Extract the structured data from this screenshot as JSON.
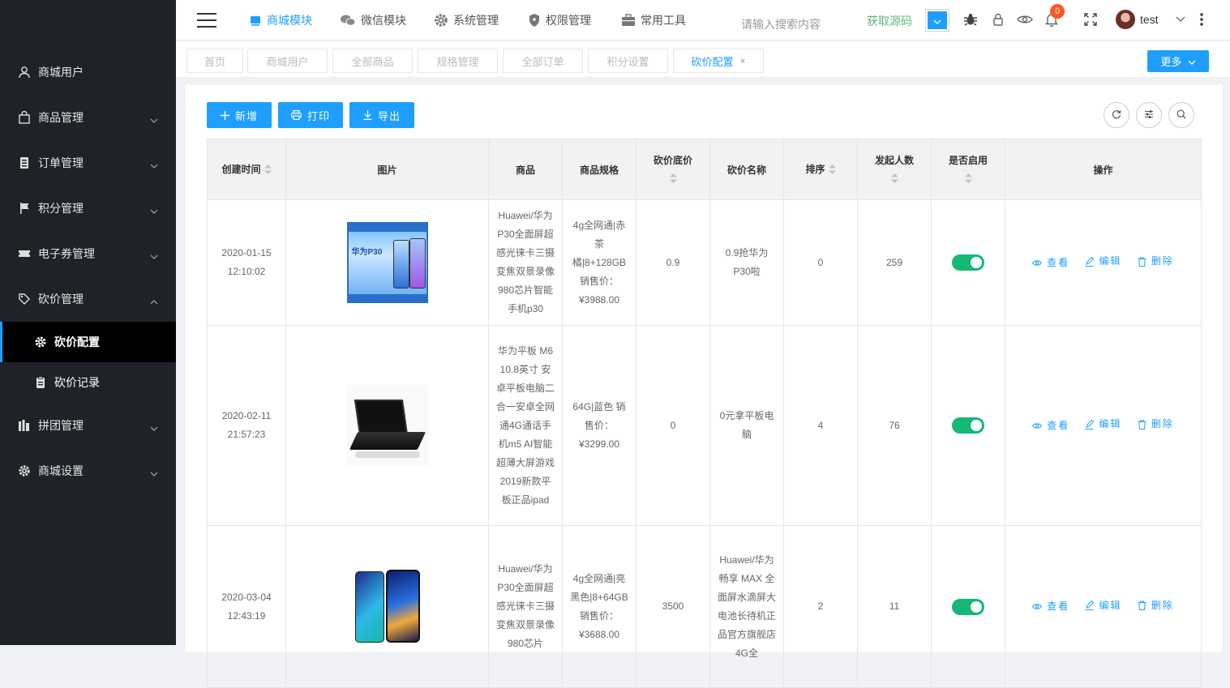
{
  "sidebar": {
    "items": [
      {
        "label": "商城用户",
        "icon": "user-icon"
      },
      {
        "label": "商品管理",
        "icon": "shop-icon"
      },
      {
        "label": "订单管理",
        "icon": "list-icon"
      },
      {
        "label": "积分管理",
        "icon": "flag-icon"
      },
      {
        "label": "电子券管理",
        "icon": "ticket-icon"
      },
      {
        "label": "砍价管理",
        "icon": "tag-icon"
      },
      {
        "label": "拼团管理",
        "icon": "bars-icon"
      },
      {
        "label": "商城设置",
        "icon": "gear-icon"
      }
    ],
    "subitems": [
      {
        "label": "砍价配置",
        "icon": "gear-icon",
        "active": true
      },
      {
        "label": "砍价记录",
        "icon": "clipboard-icon",
        "active": false
      }
    ]
  },
  "topbar": {
    "nav": [
      {
        "label": "商城模块",
        "icon": "store-icon",
        "active": true
      },
      {
        "label": "微信模块",
        "icon": "wechat-icon",
        "active": false
      },
      {
        "label": "系统管理",
        "icon": "gear-icon",
        "active": false
      },
      {
        "label": "权限管理",
        "icon": "shield-icon",
        "active": false
      },
      {
        "label": "常用工具",
        "icon": "toolbox-icon",
        "active": false
      }
    ],
    "search_placeholder": "请输入搜索内容",
    "get_source": "获取源码",
    "badge_count": "0",
    "username": "test"
  },
  "tabs": {
    "items": [
      {
        "label": "首页",
        "active": false
      },
      {
        "label": "商城用户",
        "active": false
      },
      {
        "label": "全部商品",
        "active": false
      },
      {
        "label": "规格管理",
        "active": false
      },
      {
        "label": "全部订单",
        "active": false
      },
      {
        "label": "积分设置",
        "active": false
      },
      {
        "label": "砍价配置",
        "active": true
      }
    ],
    "close_glyph": "×",
    "more_label": "更多"
  },
  "toolbar": {
    "add_label": "新增",
    "print_label": "打印",
    "export_label": "导出"
  },
  "table": {
    "columns": [
      "创建时间",
      "图片",
      "商品",
      "商品规格",
      "砍价底价",
      "砍价名称",
      "排序",
      "发起人数",
      "是否启用",
      "操作"
    ],
    "actions": {
      "view": "查看",
      "edit": "编辑",
      "delete": "删除"
    },
    "rows": [
      {
        "created": "2020-01-15 12:10:02",
        "image": "huawei-p30-banner",
        "product": "Huawei/华为P30全面屏超感光徕卡三摄变焦双景录像980芯片智能手机p30",
        "spec": "4g全网通|赤茶橘|8+128GB 销售价：¥3988.00",
        "floor_price": "0.9",
        "name": "0.9抢华为P30啦",
        "sort": "0",
        "initiators": "259",
        "enabled": true
      },
      {
        "created": "2020-02-11 21:57:23",
        "image": "laptop",
        "product": "华为平板 M6 10.8英寸 安卓平板电脑二合一安卓全网通4G通话手机m5 AI智能超薄大屏游戏2019新款平板正品ipad",
        "spec": "64G|蓝色 销售价：¥3299.00",
        "floor_price": "0",
        "name": "0元拿平板电脑",
        "sort": "4",
        "initiators": "76",
        "enabled": true
      },
      {
        "created": "2020-03-04 12:43:19",
        "image": "huawei-p30-phones",
        "product": "Huawei/华为P30全面屏超感光徕卡三摄变焦双景录像980芯片",
        "spec": "4g全网通|亮黑色|8+64GB 销售价：¥3688.00",
        "floor_price": "3500",
        "name": "Huawei/华为畅享 MAX 全面屏水滴屏大电池长待机正品官方旗舰店 4G全",
        "sort": "2",
        "initiators": "11",
        "enabled": true
      }
    ]
  },
  "colors": {
    "accent": "#1e9fff",
    "sidebar": "#20222a",
    "toggle_on": "#16b777",
    "badge": "#ff5722",
    "get_source": "#5fb878"
  }
}
